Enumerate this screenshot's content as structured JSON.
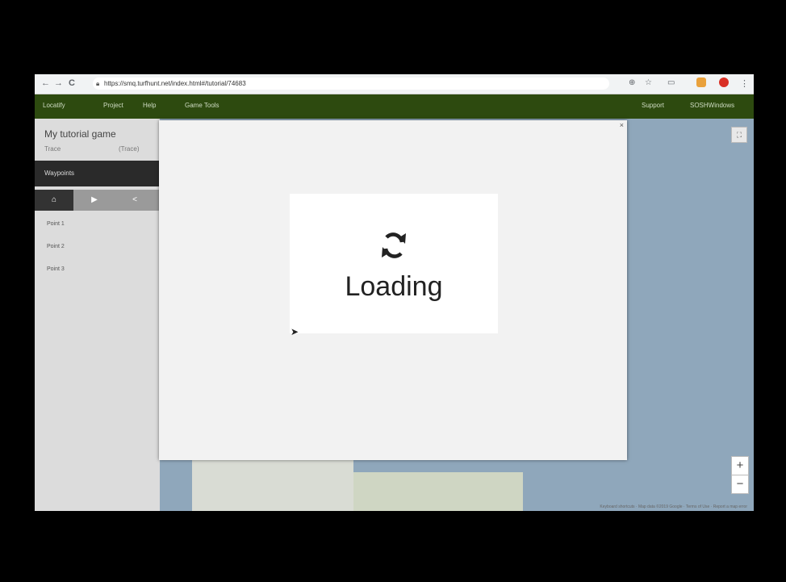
{
  "browser": {
    "url": "https://smq.turfhunt.net/index.html#/tutorial/74683",
    "nav_back": "←",
    "nav_forward": "→",
    "nav_reload": "C"
  },
  "appbar": {
    "logo": "Locatify",
    "menu": [
      "Project",
      "Help",
      "Game Tools"
    ],
    "right": [
      "Support",
      "SOSHWindows"
    ]
  },
  "sidebar": {
    "game_title": "My tutorial game",
    "subtitle": "Trace",
    "subtitle_right": "(Trace)",
    "section": "Waypoints",
    "tabs": [
      "⌂",
      "▶",
      "<"
    ],
    "items": [
      "Point 1",
      "Point 2",
      "Point 3"
    ]
  },
  "map": {
    "zoom_in": "+",
    "zoom_out": "−",
    "fullscreen": "⛶",
    "attribution": "Keyboard shortcuts · Map data ©2019 Google · Terms of Use · Report a map error"
  },
  "modal": {
    "close": "×",
    "loading_text": "Loading",
    "loading_icon": "sync-icon"
  }
}
